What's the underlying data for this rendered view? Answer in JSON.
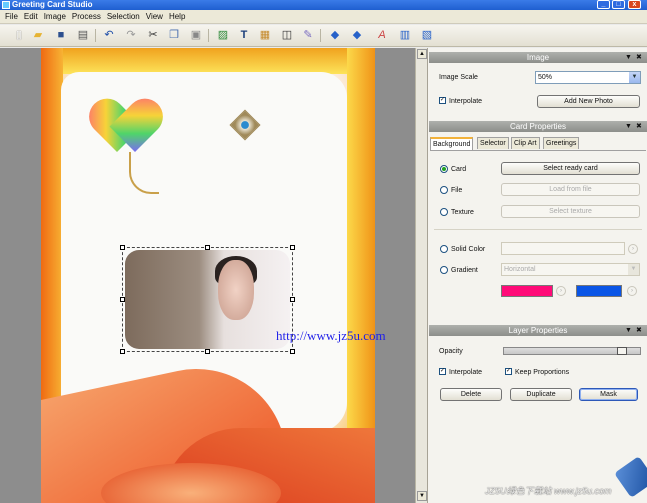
{
  "window": {
    "title": "Greeting Card Studio",
    "minimize": "_",
    "maximize": "□",
    "close": "x"
  },
  "menu": [
    "File",
    "Edit",
    "Image",
    "Process",
    "Selection",
    "View",
    "Help"
  ],
  "canvas": {
    "watermark_url": "http://www.jz5u.com",
    "scroll_up": "▲",
    "scroll_down": "▼"
  },
  "image_section": {
    "title": "Image",
    "image_scale_label": "Image Scale",
    "image_scale_value": "50%",
    "interpolate_label": "Interpolate",
    "interpolate_checked": true,
    "add_photo_label": "Add New Photo"
  },
  "card_properties": {
    "title": "Card Properties",
    "tabs": [
      "Background",
      "Selector",
      "Clip Art",
      "Greetings"
    ],
    "active_tab": "Background",
    "card_label": "Card",
    "select_card_label": "Select ready card",
    "file_label": "File",
    "load_file_label": "Load from file",
    "texture_label": "Texture",
    "select_texture_label": "Select texture",
    "solid_color_label": "Solid Color",
    "gradient_label": "Gradient",
    "gradient_value": "Horizontal",
    "color1": "#ff0a78",
    "color2": "#0a55e6"
  },
  "layer_properties": {
    "title": "Layer Properties",
    "opacity_label": "Opacity",
    "opacity_value": 0.9,
    "interpolate_label": "Interpolate",
    "interpolate_checked": true,
    "keep_proportions_label": "Keep Proportions",
    "keep_proportions_checked": true,
    "delete_label": "Delete",
    "duplicate_label": "Duplicate",
    "mask_label": "Mask"
  },
  "section_controls": {
    "collapse": "▼",
    "close": "✖"
  },
  "footer_watermark": "JZ5U绿色下载站 www.jz5u.com"
}
